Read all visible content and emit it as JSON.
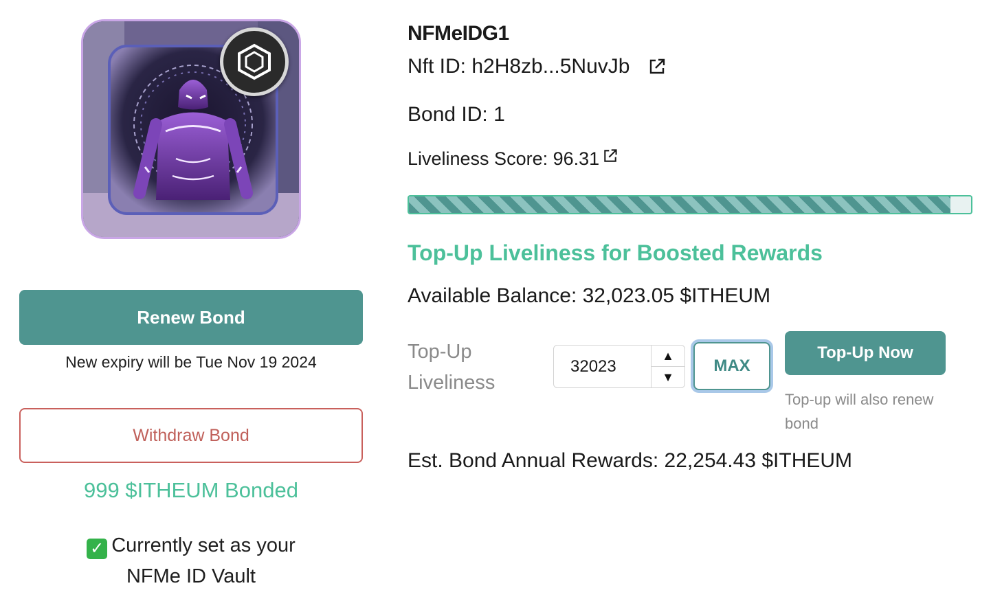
{
  "left": {
    "nft_image_alt": "NFMe ID avatar",
    "renew_label": "Renew Bond",
    "expiry_text": "New expiry will be Tue Nov 19 2024",
    "withdraw_label": "Withdraw Bond",
    "bonded_text": "999 $ITHEUM Bonded",
    "vault_line1": "Currently set as your",
    "vault_line2": "NFMe ID Vault",
    "check_glyph": "✓"
  },
  "right": {
    "title": "NFMeIDG1",
    "nft_id": "Nft ID: h2H8zb...5NuvJb",
    "bond_id": "Bond ID: 1",
    "liveliness_score": "Liveliness Score: 96.31",
    "liveliness_percent": 96.31,
    "topup_heading": "Top-Up Liveliness for Boosted Rewards",
    "available_balance": "Available Balance: 32,023.05 $ITHEUM",
    "topup_label": "Top-Up Liveliness",
    "topup_value": "32023",
    "stepper_up": "▲",
    "stepper_down": "▼",
    "max_label": "MAX",
    "topup_button": "Top-Up Now",
    "topup_note": "Top-up will also renew bond",
    "est_rewards": "Est. Bond Annual Rewards: 22,254.43 $ITHEUM"
  },
  "colors": {
    "primary": "#4f9590",
    "accent_green": "#4cc09a",
    "danger": "#c9605c"
  }
}
